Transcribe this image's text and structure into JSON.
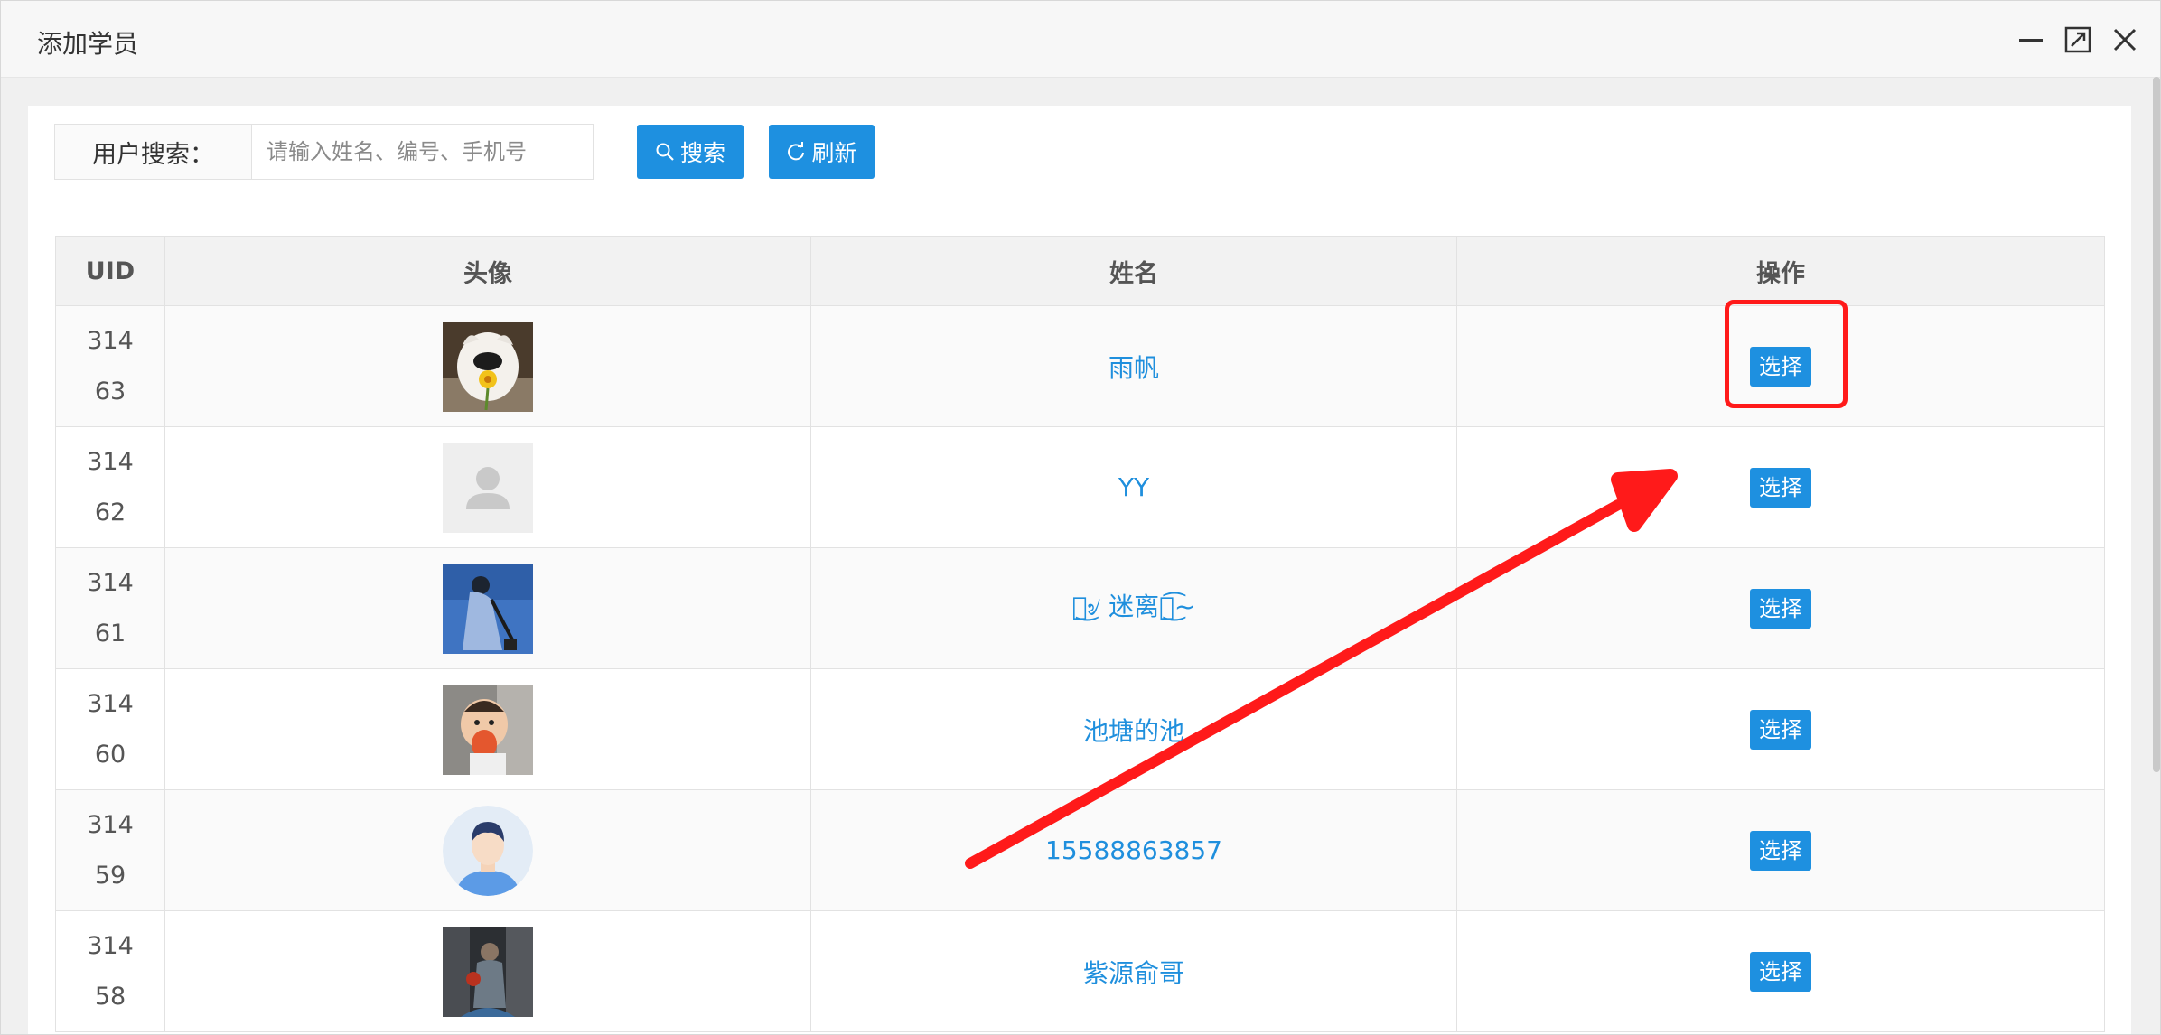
{
  "dialog": {
    "title": "添加学员",
    "icons": [
      "minimize-icon",
      "maximize-icon",
      "close-icon"
    ]
  },
  "search": {
    "label": "用户搜索：",
    "placeholder": "请输入姓名、编号、手机号",
    "search_button": "搜索",
    "refresh_button": "刷新"
  },
  "table": {
    "headers": [
      "UID",
      "头像",
      "姓名",
      "操作"
    ],
    "rows": [
      {
        "uid_line1": "314",
        "uid_line2": "63",
        "name": "雨帆",
        "action": "选择",
        "avatar": "dog-photo"
      },
      {
        "uid_line1": "314",
        "uid_line2": "62",
        "name": "YY",
        "action": "选择",
        "avatar": "default-user-icon"
      },
      {
        "uid_line1": "314",
        "uid_line2": "61",
        "name": "৩͜৶ 迷离ঞ͜͡~",
        "action": "选择",
        "avatar": "person-blue-coat-photo"
      },
      {
        "uid_line1": "314",
        "uid_line2": "60",
        "name": "池塘的池",
        "action": "选择",
        "avatar": "baby-photo"
      },
      {
        "uid_line1": "314",
        "uid_line2": "59",
        "name": "15588863857",
        "action": "选择",
        "avatar": "cartoon-man-avatar"
      },
      {
        "uid_line1": "314",
        "uid_line2": "58",
        "name": "紫源俞哥",
        "action": "选择",
        "avatar": "dark-scene-photo"
      }
    ]
  },
  "colors": {
    "primary": "#1e90e0",
    "link": "#1f8fdd",
    "annotation": "#ff1a1a"
  }
}
